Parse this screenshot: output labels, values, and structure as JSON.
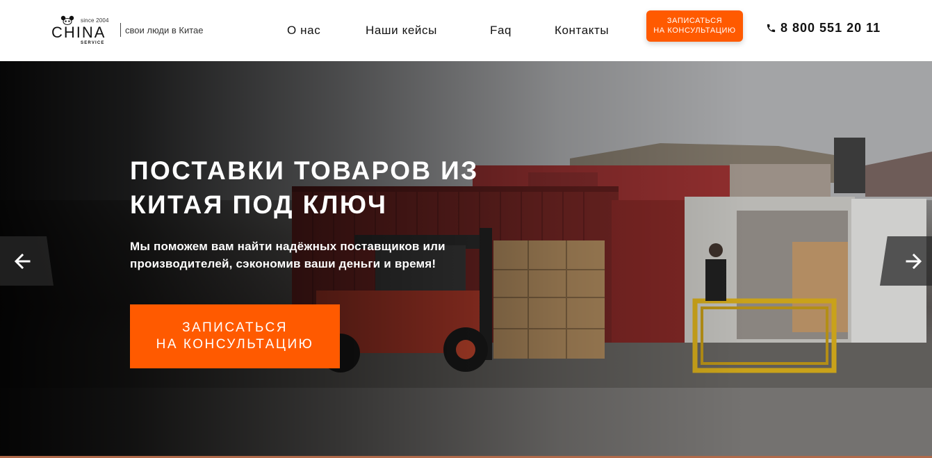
{
  "header": {
    "logo": {
      "since": "since 2004",
      "name": "CHINA",
      "service": "SERVICE"
    },
    "tagline": "свои люди в Китае",
    "nav": [
      {
        "label": "О нас"
      },
      {
        "label": "Наши кейсы"
      },
      {
        "label": "Faq"
      },
      {
        "label": "Контакты"
      }
    ],
    "cta_line1": "ЗАПИСАТЬСЯ",
    "cta_line2": "НА КОНСУЛЬТАЦИЮ",
    "phone": "8 800 551 20 11",
    "phone_icon": "phone-icon",
    "accent_color": "#ff5a00"
  },
  "hero": {
    "title": "ПОСТАВКИ ТОВАРОВ ИЗ КИТАЯ ПОД КЛЮЧ",
    "subtitle": "Мы поможем вам найти надёжных поставщиков или производителей, сэкономив ваши деньги и время!",
    "cta_line1": "ЗАПИСАТЬСЯ",
    "cta_line2": "НА КОНСУЛЬТАЦИЮ",
    "prev_icon": "arrow-left-icon",
    "next_icon": "arrow-right-icon",
    "image": "warehouse-containers-forklift-photo"
  }
}
